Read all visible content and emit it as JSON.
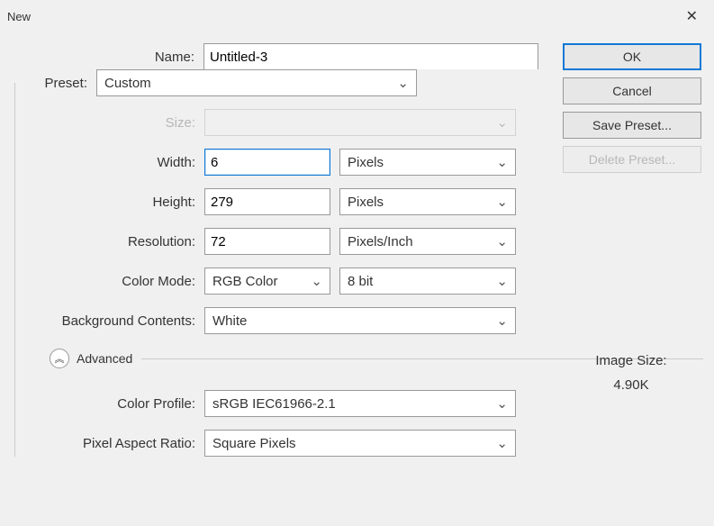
{
  "window": {
    "title": "New"
  },
  "labels": {
    "name": "Name:",
    "preset": "Preset:",
    "size": "Size:",
    "width": "Width:",
    "height": "Height:",
    "resolution": "Resolution:",
    "color_mode": "Color Mode:",
    "bg_contents": "Background Contents:",
    "advanced": "Advanced",
    "color_profile": "Color Profile:",
    "pixel_aspect": "Pixel Aspect Ratio:",
    "image_size": "Image Size:"
  },
  "values": {
    "name": "Untitled-3",
    "preset": "Custom",
    "size": "",
    "width": "6",
    "width_unit": "Pixels",
    "height": "279",
    "height_unit": "Pixels",
    "resolution": "72",
    "resolution_unit": "Pixels/Inch",
    "color_mode": "RGB Color",
    "bit_depth": "8 bit",
    "bg_contents": "White",
    "color_profile": "sRGB IEC61966-2.1",
    "pixel_aspect": "Square Pixels",
    "image_size": "4.90K"
  },
  "buttons": {
    "ok": "OK",
    "cancel": "Cancel",
    "save_preset": "Save Preset...",
    "delete_preset": "Delete Preset..."
  },
  "icons": {
    "chevron": "⌄",
    "collapse": "︽"
  }
}
